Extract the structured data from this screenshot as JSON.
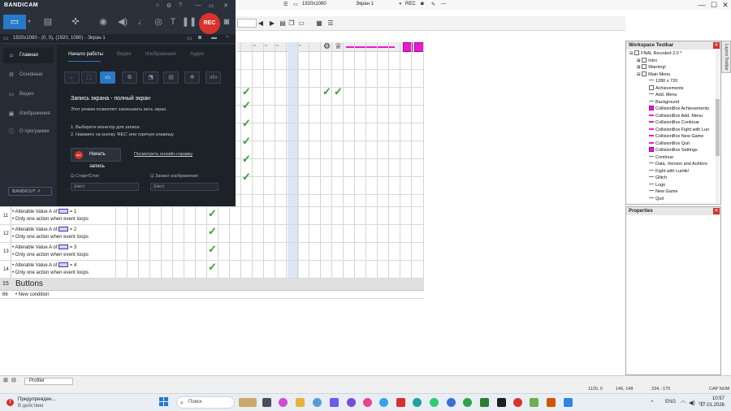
{
  "editor": {
    "resolution": "1920x1080",
    "screen": "Экран 1",
    "rec": "REC",
    "events": [
      {
        "num": "11",
        "line1": "Alterable Value A of",
        "value": "= 1",
        "line2": "Only one action when event loops"
      },
      {
        "num": "12",
        "line1": "Alterable Value A of",
        "value": "= 2",
        "line2": "Only one action when event loops"
      },
      {
        "num": "13",
        "line1": "Alterable Value A of",
        "value": "= 3",
        "line2": "Only one action when event loops"
      },
      {
        "num": "14",
        "line1": "Alterable Value A of",
        "value": "= 4",
        "line2": "Only one action when event loops"
      }
    ],
    "group": {
      "num": "15",
      "title": "Buttons"
    },
    "new_condition": {
      "num": "66",
      "label": "New condition"
    }
  },
  "workspace": {
    "title": "Workspace Toolbar",
    "items": [
      {
        "label": "FNAL Recoded 2.0 *",
        "icon": "app-icon"
      },
      {
        "label": "Intro",
        "icon": "frame-icon"
      },
      {
        "label": "Warning!",
        "icon": "frame-icon"
      },
      {
        "label": "Main Menu",
        "icon": "frame-icon"
      },
      {
        "label": "1280 x 720",
        "icon": "line-icon"
      },
      {
        "label": "Achievements",
        "icon": "text-icon"
      },
      {
        "label": "Add. Menu",
        "icon": "line-icon"
      },
      {
        "label": "Background",
        "icon": "background-icon"
      },
      {
        "label": "CollisionBox Achievements",
        "icon": "collision-box-icon"
      },
      {
        "label": "CollisionBox Add. Menu",
        "icon": "collision-line-icon"
      },
      {
        "label": "CollisionBox Continue",
        "icon": "collision-line-icon"
      },
      {
        "label": "CollisionBox Fight with Lun",
        "icon": "collision-line-icon"
      },
      {
        "label": "CollisionBox New Game",
        "icon": "collision-line-icon"
      },
      {
        "label": "CollisionBox Quit",
        "icon": "collision-line-icon"
      },
      {
        "label": "CollisionBox Settings",
        "icon": "collision-box-icon"
      },
      {
        "label": "Continue",
        "icon": "line-icon"
      },
      {
        "label": "Data, Version and Auhtors",
        "icon": "line-icon"
      },
      {
        "label": "Fight with Luntik!",
        "icon": "line-icon"
      },
      {
        "label": "Glitch",
        "icon": "line-icon"
      },
      {
        "label": "Logo",
        "icon": "line-icon"
      },
      {
        "label": "New Game",
        "icon": "line-icon"
      },
      {
        "label": "Quit",
        "icon": "line-icon"
      }
    ]
  },
  "properties": {
    "title": "Properties"
  },
  "side_tab": {
    "label": "Layers Toolbar"
  },
  "statusbar": {
    "profiler": "Profiler",
    "coord1": "1120, 0",
    "coord2": "146, 148",
    "coord3": "234, -170",
    "caps": "CAP NUM"
  },
  "bandicam": {
    "logo": "BANDICAM",
    "rec": "REC",
    "subbar": "1920x1080 - (0, 0), (1920, 1080) - Экран 1",
    "nav": [
      {
        "label": "Главная",
        "icon": "home-icon"
      },
      {
        "label": "Основные",
        "icon": "gear-icon"
      },
      {
        "label": "Видео",
        "icon": "video-icon"
      },
      {
        "label": "Изображения",
        "icon": "image-icon"
      },
      {
        "label": "О программе",
        "icon": "info-icon"
      }
    ],
    "bandicut": "BANDICUT ↗",
    "tabs": [
      "Начало работы",
      "Видео",
      "Изображения",
      "Аудио"
    ],
    "heading": "Запись экрана - полный экран",
    "desc": "Этот режим позволяет записывать весь экран.",
    "step1": "1. Выберите монитор для записи.",
    "step2": "2. Нажмите на кнопку 'REC' или горячую клавишу.",
    "start_button": "Начать запись",
    "start_button_icon": "REC",
    "help_link": "Посмотреть онлайн-справку",
    "hotkey_start_label": "Старт/Стоп",
    "hotkey_start_value": "(Нет)",
    "hotkey_capture_label": "Захват изображения",
    "hotkey_capture_value": "(Нет)"
  },
  "taskbar": {
    "weather_line1": "Предупрежден...",
    "weather_line2": "В действии",
    "search": "Поиск",
    "lang": "ENG",
    "time": "10:57",
    "date": "17.01.2026"
  },
  "colors": {
    "bandicam_accent": "#2879c8",
    "rec_red": "#d9332b",
    "check_green": "#2e9e2e",
    "object_magenta": "#e81ccd"
  }
}
